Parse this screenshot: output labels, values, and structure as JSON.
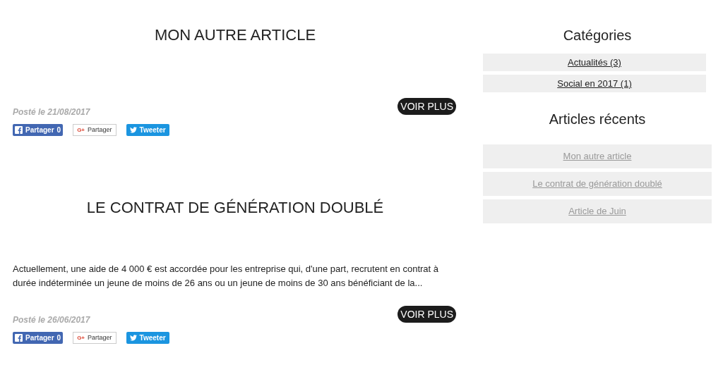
{
  "articles": [
    {
      "title": "MON AUTRE ARTICLE",
      "date": "Posté le 21/08/2017",
      "more": "VOIR PLUS",
      "share": {
        "facebook": "Partager",
        "facebook_count": "0",
        "google_mark": "G+",
        "google": "Partager",
        "twitter": "Tweeter"
      }
    },
    {
      "title": "LE CONTRAT DE GÉNÉRATION DOUBLÉ",
      "excerpt": "Actuellement, une aide de 4 000 € est accordée pour les entreprise qui, d'une part, recrutent en contrat à durée indéterminée un jeune de moins de 26 ans ou un jeune de moins de 30 ans bénéficiant de la...",
      "date": "Posté le 26/06/2017",
      "more": "VOIR PLUS",
      "share": {
        "facebook": "Partager",
        "facebook_count": "0",
        "google_mark": "G+",
        "google": "Partager",
        "twitter": "Tweeter"
      }
    }
  ],
  "sidebar": {
    "categories_title": "Catégories",
    "categories": [
      "Actualités (3)",
      "Social en 2017 (1)"
    ],
    "recent_title": "Articles récents",
    "recent": [
      "Mon autre article",
      "Le contrat de génération doublé",
      "Article de Juin"
    ]
  }
}
